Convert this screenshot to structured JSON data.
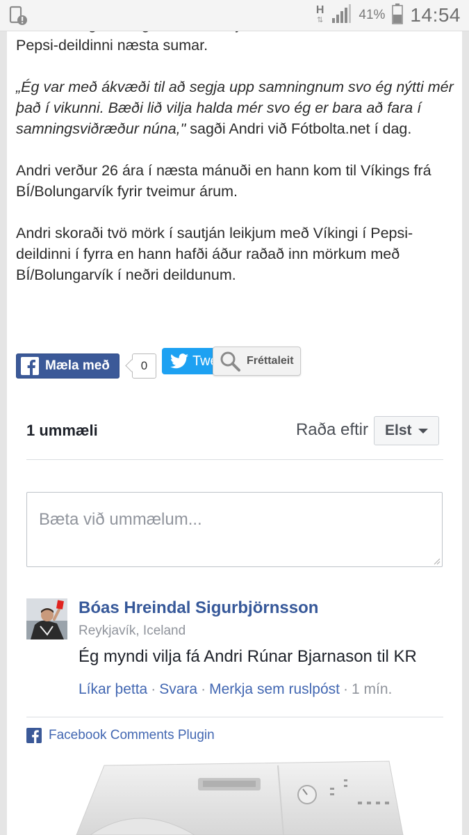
{
  "status_bar": {
    "network": "H",
    "battery_percent": "41%",
    "time": "14:54"
  },
  "article": {
    "p0": "Bæði Víkingur R. og Grindavík vilja hafa Andra í sínum röðum í Pepsi-deildinni næsta sumar.",
    "p1_quote": "„Ég var með ákvæði til að segja upp samningnum svo ég nýtti mér það í vikunni. Bæði lið vilja halda mér svo ég er bara að fara í samningsviðræður núna,\"",
    "p1_rest": " sagði Andri við Fótbolta.net í dag.",
    "p2": "Andri verður 26 ára í næsta mánuði en hann kom til Víkings frá BÍ/Bolungarvík fyrir tveimur árum.",
    "p3": "Andri skoraði tvö mörk í sautján leikjum með Víkingi í Pepsi-deildinni í fyrra en hann hafði áður raðað inn mörkum með BÍ/Bolungarvík í neðri deildunum."
  },
  "share": {
    "like_label": "Mæla með",
    "like_count": "0",
    "tweet_label": "Twe",
    "search_label": "Fréttaleit"
  },
  "comments": {
    "count_label": "1 ummæli",
    "sort_label": "Raða eftir",
    "sort_value": "Elst",
    "input_placeholder": "Bæta við ummælum...",
    "items": [
      {
        "author": "Bóas Hreindal Sigurbjörnsson",
        "location": "Reykjavík, Iceland",
        "text": "Ég myndi vilja fá Andri Rúnar Bjarnason til KR",
        "like": "Líkar þetta",
        "reply": "Svara",
        "spam": "Merkja sem ruslpóst",
        "time": "1 mín."
      }
    ],
    "plugin_label": "Facebook Comments Plugin"
  },
  "colors": {
    "facebook_blue": "#3b5998",
    "link_blue": "#4267b2",
    "name_blue": "#365899",
    "twitter_blue": "#1da1f2"
  }
}
